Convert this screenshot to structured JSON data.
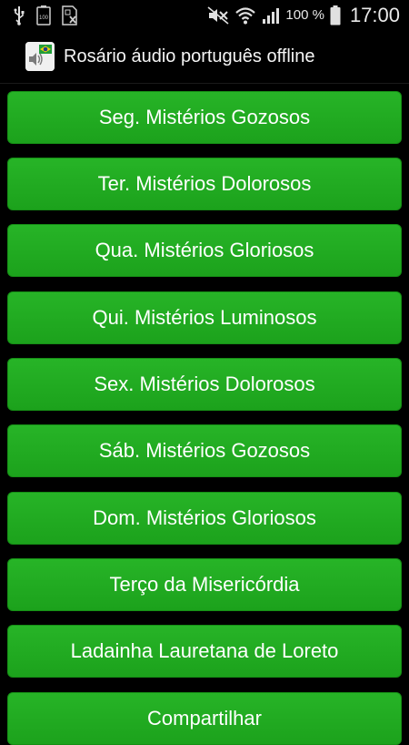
{
  "status_bar": {
    "battery_percent": "100 %",
    "time": "17:00",
    "icons": [
      "usb-icon",
      "battery-status-icon",
      "no-sim-icon",
      "mute-icon",
      "wifi-icon",
      "signal-icon",
      "battery-icon"
    ],
    "small_battery_label": "100"
  },
  "app_bar": {
    "title": "Rosário áudio português offline",
    "icon": "app-icon"
  },
  "colors": {
    "button_green": "#1ca21c",
    "background": "#000000"
  },
  "menu": {
    "items": [
      {
        "label": "Seg. Mistérios Gozosos"
      },
      {
        "label": "Ter. Mistérios Dolorosos"
      },
      {
        "label": "Qua. Mistérios Gloriosos"
      },
      {
        "label": "Qui. Mistérios Luminosos"
      },
      {
        "label": "Sex. Mistérios Dolorosos"
      },
      {
        "label": "Sáb. Mistérios Gozosos"
      },
      {
        "label": "Dom. Mistérios Gloriosos"
      },
      {
        "label": "Terço da Misericórdia"
      },
      {
        "label": "Ladainha Lauretana de Loreto"
      },
      {
        "label": "Compartilhar"
      }
    ]
  }
}
